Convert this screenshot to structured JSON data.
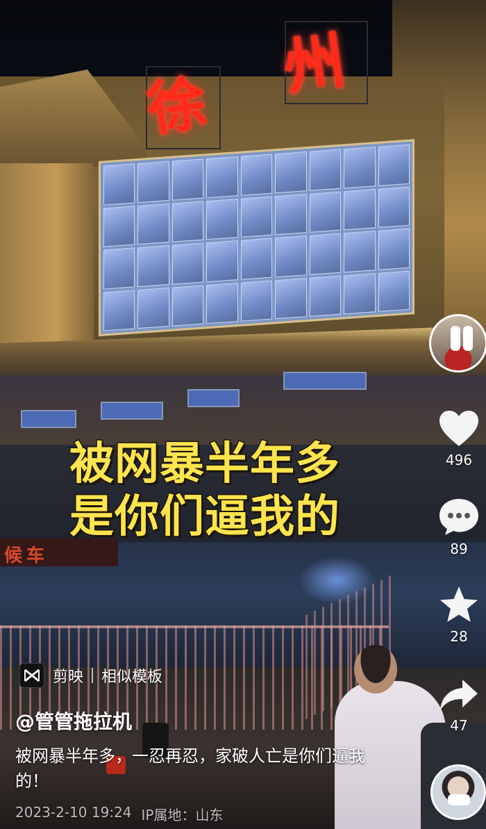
{
  "video": {
    "neon_sign": [
      "徐",
      "州"
    ],
    "caption_lines": [
      "被网暴半年多",
      "是你们逼我的"
    ],
    "entrance_sign": "候车"
  },
  "right_rail": {
    "likes": "496",
    "comments": "89",
    "favorites": "28",
    "shares": "47"
  },
  "info": {
    "template_app": "剪映",
    "template_link": "相似模板",
    "username": "@管管拖拉机",
    "description": "被网暴半年多，一忍再忍，家破人亡是你们逼我的！",
    "date": "2023-2-10 19:24",
    "ip_location": "IP属地：山东"
  },
  "colors": {
    "caption_yellow": "#ffe44d",
    "neon_red": "#ff2a1a"
  }
}
